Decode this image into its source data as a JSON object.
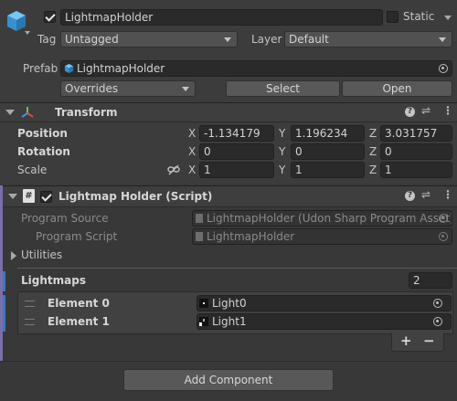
{
  "header": {
    "object_name": "LightmapHolder",
    "active": true,
    "static_label": "Static",
    "static_checked": false,
    "tag_label": "Tag",
    "tag_value": "Untagged",
    "layer_label": "Layer",
    "layer_value": "Default",
    "prefab_label": "Prefab",
    "prefab_value": "LightmapHolder",
    "overrides_label": "Overrides",
    "select_label": "Select",
    "open_label": "Open"
  },
  "transform": {
    "title": "Transform",
    "rows": [
      {
        "label": "Position",
        "x": "-1.134179",
        "y": "1.196234",
        "z": "3.031757"
      },
      {
        "label": "Rotation",
        "x": "0",
        "y": "0",
        "z": "0"
      },
      {
        "label": "Scale",
        "x": "1",
        "y": "1",
        "z": "1"
      }
    ],
    "axis_x": "X",
    "axis_y": "Y",
    "axis_z": "Z"
  },
  "script_component": {
    "title": "Lightmap Holder (Script)",
    "enabled": true,
    "program_source_label": "Program Source",
    "program_source_value": "LightmapHolder (Udon Sharp Program Asset)",
    "program_script_label": "Program Script",
    "program_script_value": "LightmapHolder",
    "utilities_label": "Utilities",
    "lightmaps_label": "Lightmaps",
    "lightmaps_count": "2",
    "elements": [
      {
        "label": "Element 0",
        "value": "Light0"
      },
      {
        "label": "Element 1",
        "value": "Light1"
      }
    ],
    "add_symbol": "+",
    "remove_symbol": "−"
  },
  "footer": {
    "add_component_label": "Add Component"
  },
  "icons": {
    "gameobject": "cube-icon",
    "transform": "transform-axes-icon",
    "script": "script-icon",
    "help": "help-icon",
    "presets": "presets-icon",
    "menu": "kebab-menu-icon",
    "object_picker": "target-icon",
    "link": "link-icon"
  },
  "colors": {
    "background": "#383838",
    "accent_bar": "#7c6ea8",
    "selection_bar": "#3a79bb",
    "cube": "#4aa3df"
  }
}
